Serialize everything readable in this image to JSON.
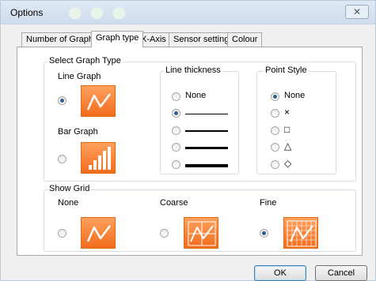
{
  "window": {
    "title": "Options",
    "close_label": "✕"
  },
  "tabs": [
    {
      "label": "Number of Graphs",
      "active": false
    },
    {
      "label": "Graph type",
      "active": true
    },
    {
      "label": "X-Axis",
      "active": false
    },
    {
      "label": "Sensor settings",
      "active": false
    },
    {
      "label": "Colour",
      "active": false
    }
  ],
  "graph_type_group": {
    "label": "Select Graph Type",
    "line_graph_label": "Line Graph",
    "bar_graph_label": "Bar Graph",
    "selected": "Line Graph"
  },
  "line_thickness": {
    "label": "Line thickness",
    "none_label": "None",
    "selected_index": 1
  },
  "point_style": {
    "label": "Point Style",
    "none_label": "None",
    "options": [
      "×",
      "□",
      "△",
      "◇"
    ],
    "selected": "None"
  },
  "show_grid": {
    "label": "Show Grid",
    "none_label": "None",
    "coarse_label": "Coarse",
    "fine_label": "Fine",
    "selected": "Fine"
  },
  "buttons": {
    "ok_label": "OK",
    "cancel_label": "Cancel"
  },
  "colors": {
    "accent_orange": "#f26c1c",
    "radio_dot": "#2f5d8c"
  }
}
